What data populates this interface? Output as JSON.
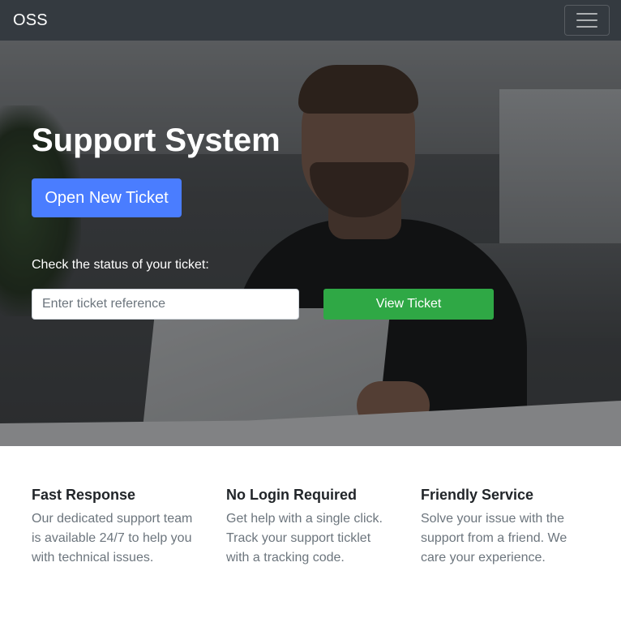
{
  "navbar": {
    "brand": "OSS"
  },
  "hero": {
    "title": "Support System",
    "open_ticket_label": "Open New Ticket",
    "status_label": "Check the status of your ticket:",
    "input_placeholder": "Enter ticket reference",
    "view_ticket_label": "View Ticket"
  },
  "features": [
    {
      "title": "Fast Response",
      "text": "Our dedicated support team is available 24/7 to help you with technical issues."
    },
    {
      "title": "No Login Required",
      "text": "Get help with a single click. Track your support ticklet with a tracking code."
    },
    {
      "title": "Friendly Service",
      "text": "Solve your issue with the support from a friend. We care your experience."
    }
  ],
  "colors": {
    "navbar_bg": "#343a40",
    "primary_button": "#4a7dff",
    "success_button": "#2fa845"
  },
  "icons": {
    "toggler": "hamburger-menu-icon"
  }
}
